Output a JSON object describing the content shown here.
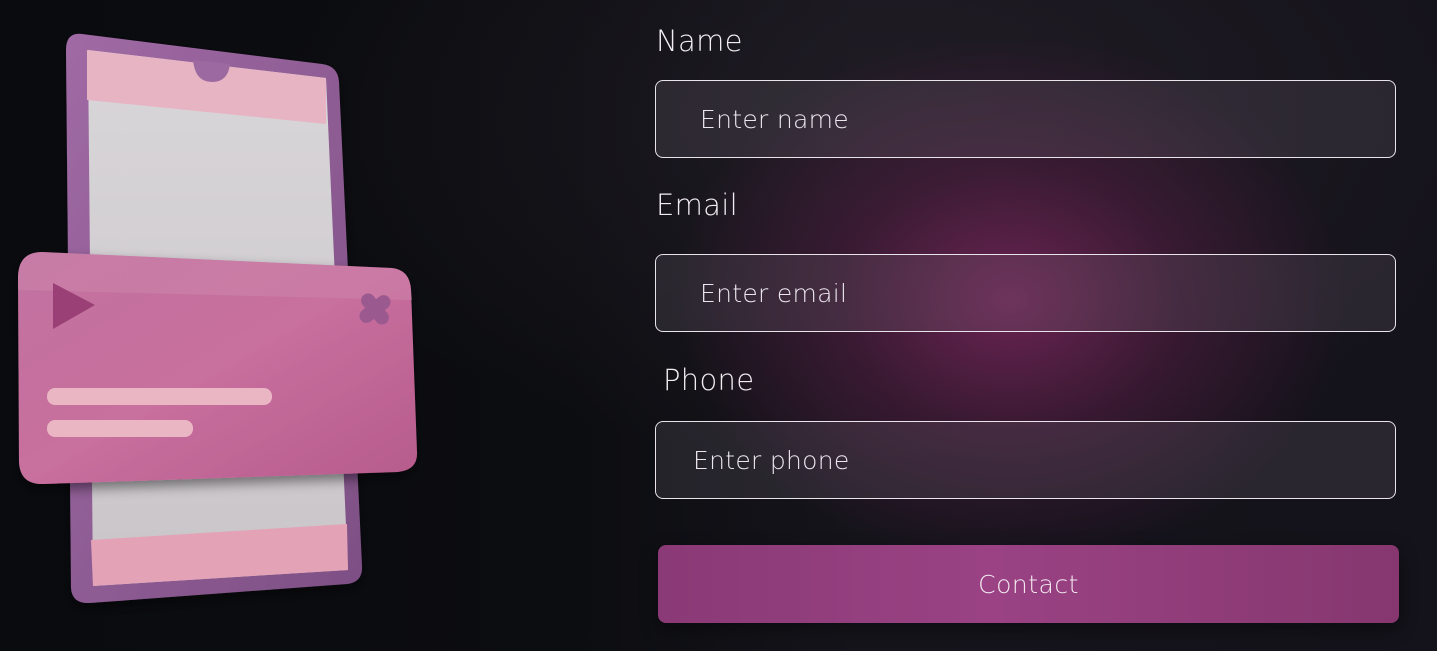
{
  "form": {
    "name": {
      "label": "Name",
      "placeholder": "Enter name",
      "value": ""
    },
    "email": {
      "label": "Email",
      "placeholder": "Enter email",
      "value": ""
    },
    "phone": {
      "label": "Phone",
      "placeholder": "Enter phone",
      "value": ""
    },
    "submit_label": "Contact"
  },
  "illustration": {
    "description_icon": "phone-popup-illustration",
    "play_icon": "play-icon",
    "close_icon": "close-icon"
  },
  "colors": {
    "accent": "#9a4284",
    "card_pink": "#c96e9c",
    "phone_frame": "#8f5f96",
    "input_border": "#e9e3ea",
    "background": "#0b0c10"
  }
}
